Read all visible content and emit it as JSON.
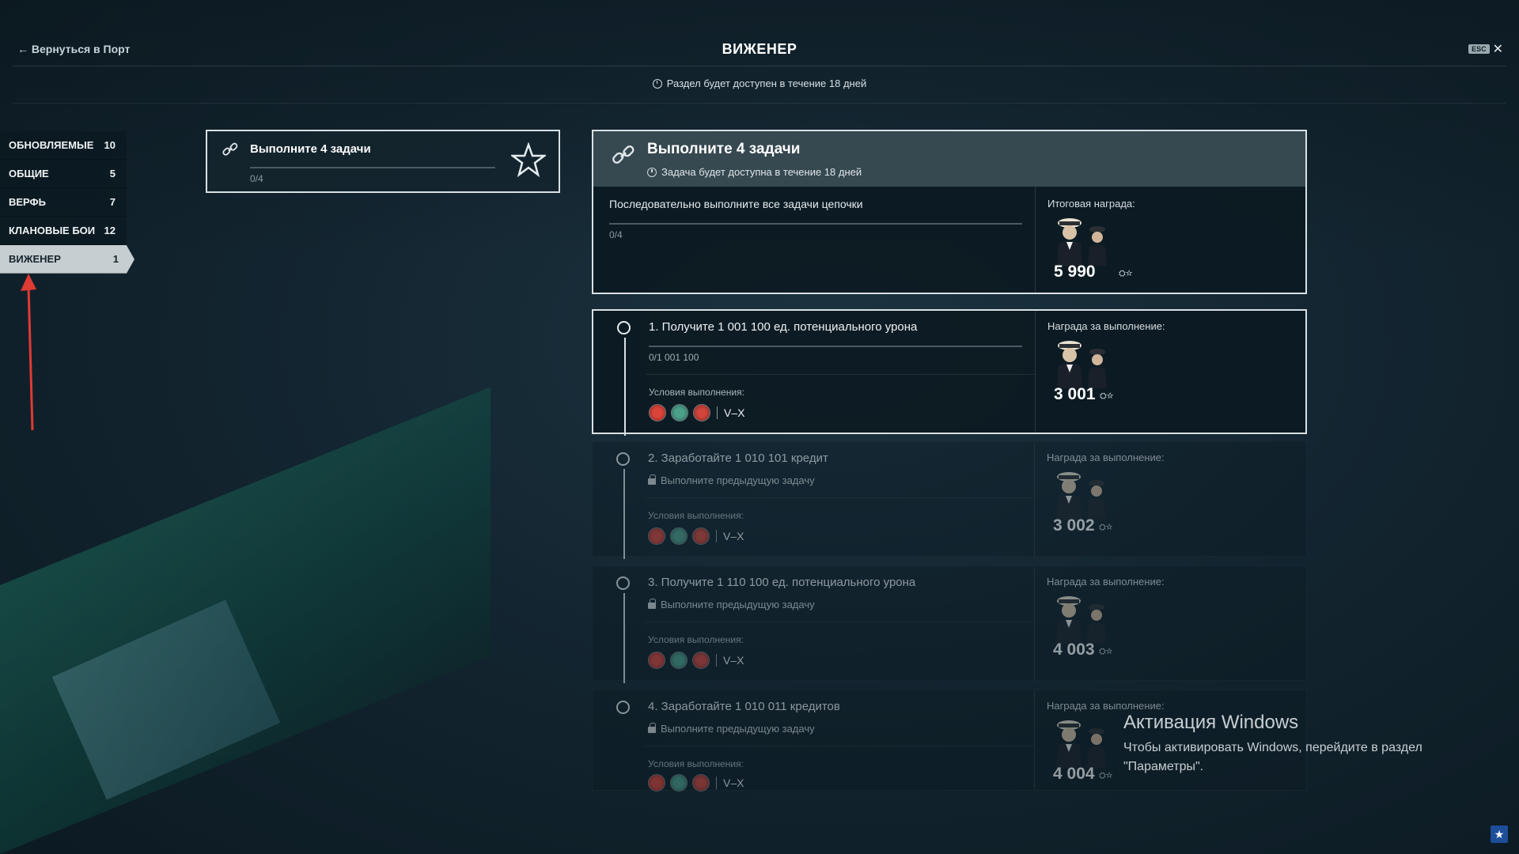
{
  "header": {
    "back_label": "← Вернуться в Порт",
    "title": "ВИЖЕНЕР",
    "esc_label": "ESC",
    "close_icon": "close-icon",
    "availability": "Раздел будет доступен в течение 18 дней"
  },
  "sidebar": {
    "items": [
      {
        "label": "ОБНОВЛЯЕМЫЕ",
        "count": "10",
        "active": false
      },
      {
        "label": "ОБЩИЕ",
        "count": "5",
        "active": false
      },
      {
        "label": "ВЕРФЬ",
        "count": "7",
        "active": false
      },
      {
        "label": "КЛАНОВЫЕ БОИ",
        "count": "12",
        "active": false
      },
      {
        "label": "ВИЖЕНЕР",
        "count": "1",
        "active": true
      }
    ]
  },
  "chain_card": {
    "title": "Выполните 4 задачи",
    "progress": "0/4",
    "icon": "link-icon",
    "badge_icon": "star-icon"
  },
  "detail": {
    "title": "Выполните 4 задачи",
    "subtitle": "Задача будет доступна в течение 18 дней",
    "description": "Последовательно выполните все задачи цепочки",
    "progress": "0/4",
    "reward_label": "Итоговая награда:",
    "reward_value": "5 990"
  },
  "tasks": [
    {
      "title": "1. Получите 1 001 100 ед. потенциального урона",
      "progress": "0/1 001 100",
      "conditions_label": "Условия выполнения:",
      "tier": "V–X",
      "reward_label": "Награда за выполнение:",
      "reward_value": "3 001",
      "locked": false
    },
    {
      "title": "2. Заработайте 1 010 101 кредит",
      "lock_text": "Выполните предыдущую задачу",
      "conditions_label": "Условия выполнения:",
      "tier": "V–X",
      "reward_label": "Награда за выполнение:",
      "reward_value": "3 002",
      "locked": true
    },
    {
      "title": "3. Получите 1 110 100 ед. потенциального урона",
      "lock_text": "Выполните предыдущую задачу",
      "conditions_label": "Условия выполнения:",
      "tier": "V–X",
      "reward_label": "Награда за выполнение:",
      "reward_value": "4 003",
      "locked": true
    },
    {
      "title": "4. Заработайте 1 010 011 кредитов",
      "lock_text": "Выполните предыдущую задачу",
      "conditions_label": "Условия выполнения:",
      "tier": "V–X",
      "reward_label": "Награда за выполнение:",
      "reward_value": "4 004",
      "locked": true
    }
  ],
  "windows_activation": {
    "title": "Активация Windows",
    "text": "Чтобы активировать Windows, перейдите в раздел \"Параметры\"."
  },
  "colors": {
    "accent": "#d9e1e4",
    "active_tab": "#c7ced2",
    "annotation_arrow": "#e03a34"
  }
}
